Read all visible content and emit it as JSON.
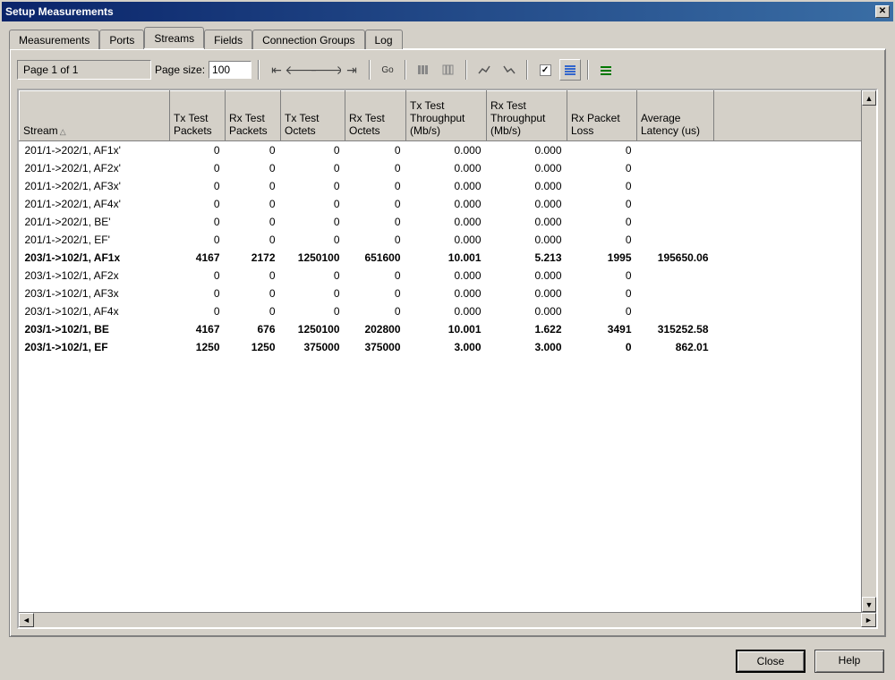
{
  "window": {
    "title": "Setup Measurements"
  },
  "tabs": [
    "Measurements",
    "Ports",
    "Streams",
    "Fields",
    "Connection Groups",
    "Log"
  ],
  "active_tab_index": 2,
  "toolbar": {
    "page_label": "Page 1 of 1",
    "page_size_label": "Page size:",
    "page_size_value": "100",
    "go_label": "Go"
  },
  "columns": [
    "Stream",
    "Tx Test Packets",
    "Rx Test Packets",
    "Tx Test Octets",
    "Rx Test Octets",
    "Tx Test Throughput (Mb/s)",
    "Rx Test Throughput (Mb/s)",
    "Rx Packet Loss",
    "Average Latency (us)"
  ],
  "rows": [
    {
      "bold": false,
      "cells": [
        "201/1->202/1, AF1x'",
        "0",
        "0",
        "0",
        "0",
        "0.000",
        "0.000",
        "0",
        ""
      ]
    },
    {
      "bold": false,
      "cells": [
        "201/1->202/1, AF2x'",
        "0",
        "0",
        "0",
        "0",
        "0.000",
        "0.000",
        "0",
        ""
      ]
    },
    {
      "bold": false,
      "cells": [
        "201/1->202/1, AF3x'",
        "0",
        "0",
        "0",
        "0",
        "0.000",
        "0.000",
        "0",
        ""
      ]
    },
    {
      "bold": false,
      "cells": [
        "201/1->202/1, AF4x'",
        "0",
        "0",
        "0",
        "0",
        "0.000",
        "0.000",
        "0",
        ""
      ]
    },
    {
      "bold": false,
      "cells": [
        "201/1->202/1, BE'",
        "0",
        "0",
        "0",
        "0",
        "0.000",
        "0.000",
        "0",
        ""
      ]
    },
    {
      "bold": false,
      "cells": [
        "201/1->202/1, EF'",
        "0",
        "0",
        "0",
        "0",
        "0.000",
        "0.000",
        "0",
        ""
      ]
    },
    {
      "bold": true,
      "cells": [
        "203/1->102/1, AF1x",
        "4167",
        "2172",
        "1250100",
        "651600",
        "10.001",
        "5.213",
        "1995",
        "195650.06"
      ]
    },
    {
      "bold": false,
      "cells": [
        "203/1->102/1, AF2x",
        "0",
        "0",
        "0",
        "0",
        "0.000",
        "0.000",
        "0",
        ""
      ]
    },
    {
      "bold": false,
      "cells": [
        "203/1->102/1, AF3x",
        "0",
        "0",
        "0",
        "0",
        "0.000",
        "0.000",
        "0",
        ""
      ]
    },
    {
      "bold": false,
      "cells": [
        "203/1->102/1, AF4x",
        "0",
        "0",
        "0",
        "0",
        "0.000",
        "0.000",
        "0",
        ""
      ]
    },
    {
      "bold": true,
      "cells": [
        "203/1->102/1, BE",
        "4167",
        "676",
        "1250100",
        "202800",
        "10.001",
        "1.622",
        "3491",
        "315252.58"
      ]
    },
    {
      "bold": true,
      "cells": [
        "203/1->102/1, EF",
        "1250",
        "1250",
        "375000",
        "375000",
        "3.000",
        "3.000",
        "0",
        "862.01"
      ]
    }
  ],
  "footer": {
    "close": "Close",
    "help": "Help"
  },
  "checkbox_checked": true
}
